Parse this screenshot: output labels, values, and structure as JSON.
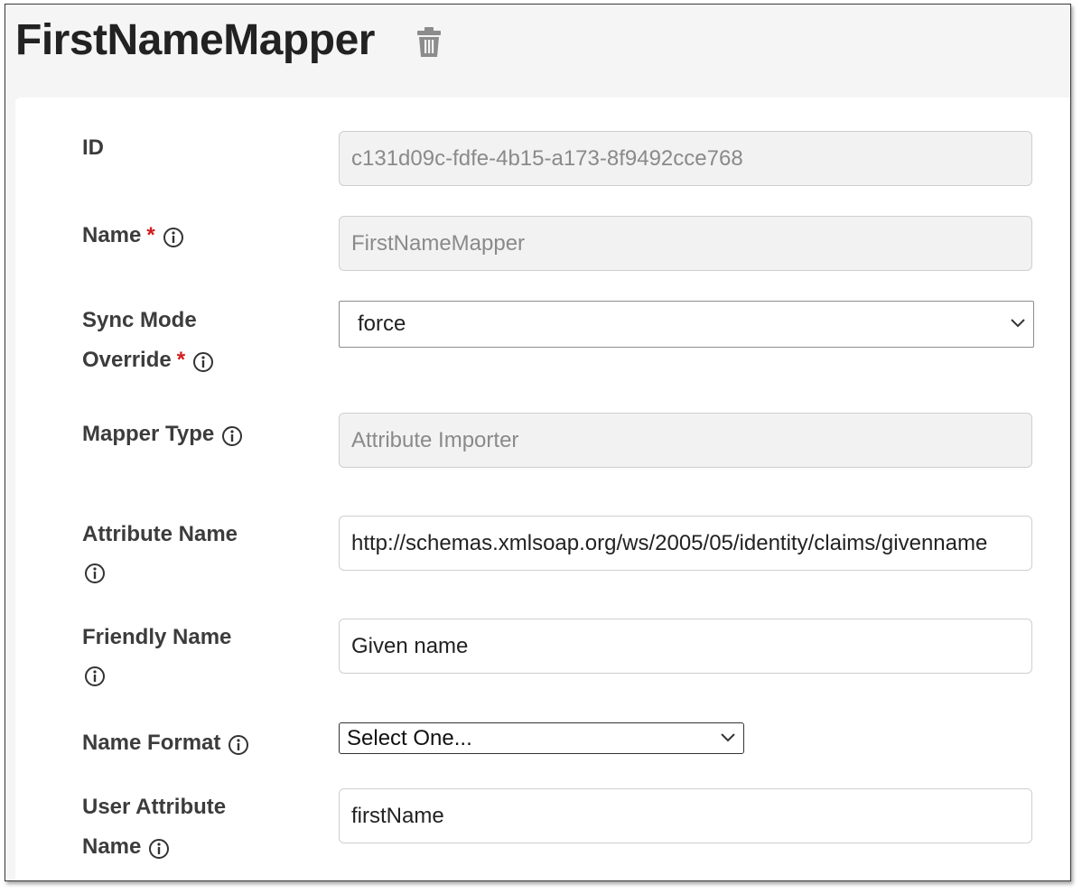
{
  "header": {
    "title": "FirstNameMapper",
    "delete_icon": "trash-icon"
  },
  "form": {
    "id": {
      "label": "ID",
      "value": "c131d09c-fdfe-4b15-a173-8f9492cce768"
    },
    "name": {
      "label": "Name",
      "required_mark": "*",
      "value": "FirstNameMapper"
    },
    "sync_mode": {
      "label_line1": "Sync Mode",
      "label_line2": "Override",
      "required_mark": "*",
      "selected": "force"
    },
    "mapper_type": {
      "label": "Mapper Type",
      "value": "Attribute Importer"
    },
    "attribute_name": {
      "label": "Attribute Name",
      "value": "http://schemas.xmlsoap.org/ws/2005/05/identity/claims/givenname"
    },
    "friendly_name": {
      "label": "Friendly Name",
      "value": "Given name"
    },
    "name_format": {
      "label": "Name Format",
      "selected": "Select One..."
    },
    "user_attribute_name": {
      "label_line1": "User Attribute",
      "label_line2": "Name",
      "value": "firstName"
    }
  },
  "colors": {
    "required": "#d01c1c",
    "readonly_bg": "#f2f2f2",
    "header_bg": "#f5f5f5"
  }
}
